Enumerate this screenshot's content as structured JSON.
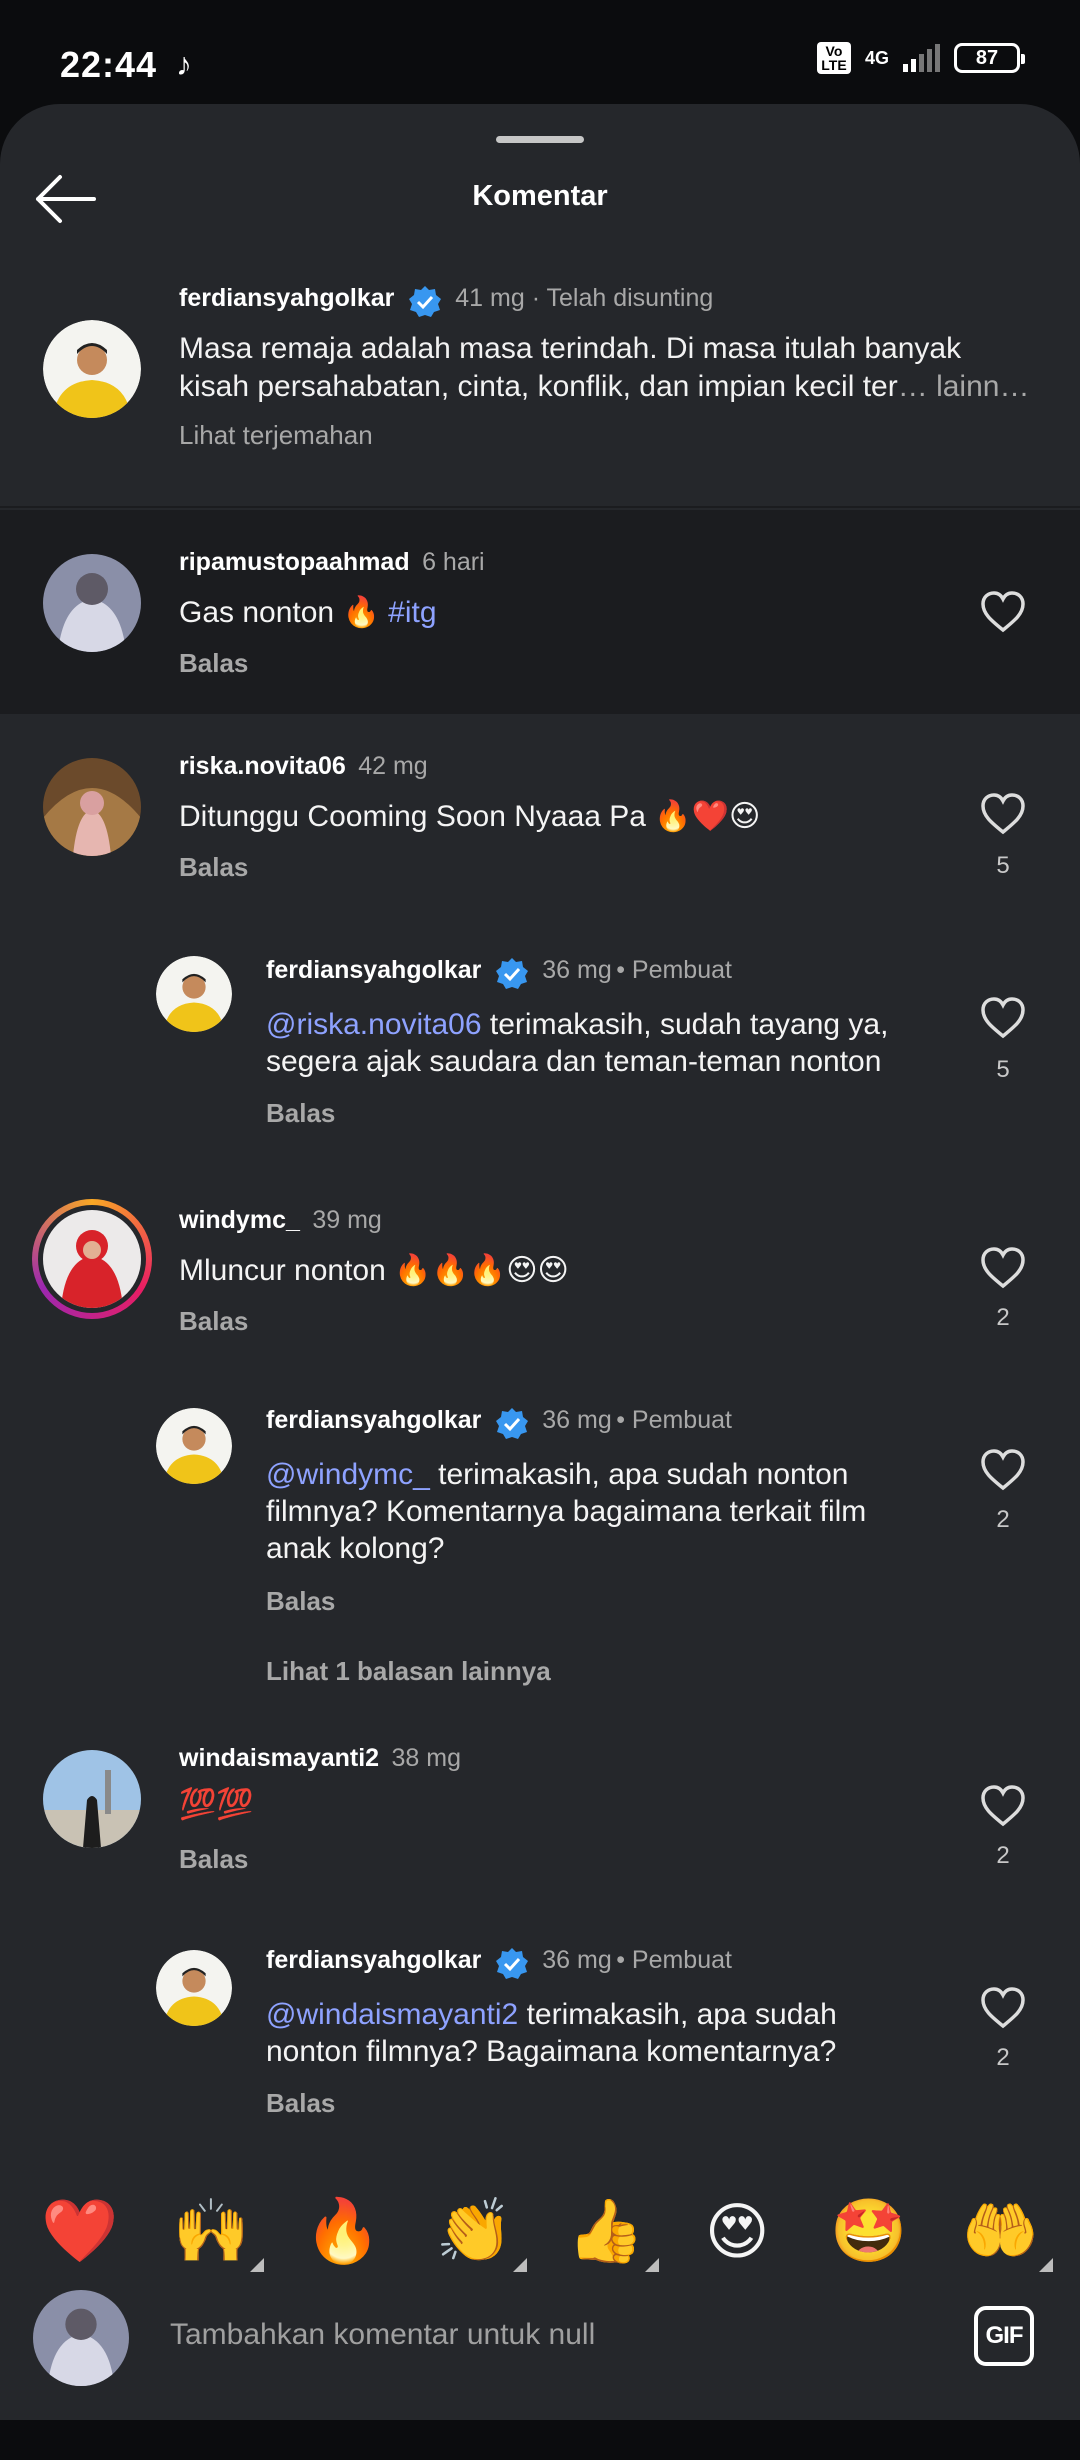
{
  "status": {
    "time": "22:44",
    "tiktok_icon": "tiktok-icon",
    "volte": "Vo LTE",
    "network": "4G",
    "battery": "87"
  },
  "header": {
    "title": "Komentar"
  },
  "caption": {
    "user": "ferdiansyahgolkar",
    "meta": "41 mg · Telah disunting",
    "line1": "Masa remaja adalah masa terindah. Di masa itulah banyak",
    "line2": "kisah persahabatan, cinta, konflik, dan impian kecil ter",
    "more": "… lainn…",
    "translate": "Lihat terjemahan"
  },
  "comments": [
    {
      "user": "ripamustopaahmad",
      "time": "6 hari",
      "text": "Gas nonton 🔥 ",
      "hashtag": "#itg",
      "reply": "Balas",
      "likes": ""
    },
    {
      "user": "riska.novita06",
      "time": "42 mg",
      "text": "Ditunggu Cooming Soon Nyaaa Pa 🔥❤️😍",
      "reply": "Balas",
      "likes": "5"
    },
    {
      "user": "ferdiansyahgolkar",
      "time": "36 mg",
      "role": "Pembuat",
      "mention": "@riska.novita06",
      "text1": " terimakasih, sudah tayang ya,",
      "text2": "segera ajak saudara dan teman-teman nonton",
      "reply": "Balas",
      "likes": "5"
    },
    {
      "user": "windymc_",
      "time": "39 mg",
      "text": "Mluncur nonton 🔥🔥🔥😍😍",
      "reply": "Balas",
      "likes": "2"
    },
    {
      "user": "ferdiansyahgolkar",
      "time": "36 mg",
      "role": "Pembuat",
      "mention": "@windymc_",
      "text1": " terimakasih, apa sudah nonton",
      "text2": "filmnya? Komentarnya bagaimana terkait film",
      "text3": "anak kolong?",
      "reply": "Balas",
      "likes": "2",
      "more_replies": "Lihat 1 balasan lainnya"
    },
    {
      "user": "windaismayanti2",
      "time": "38 mg",
      "text": "💯💯",
      "reply": "Balas",
      "likes": "2"
    },
    {
      "user": "ferdiansyahgolkar",
      "time": "36 mg",
      "role": "Pembuat",
      "mention": "@windaismayanti2",
      "text1": " terimakasih, apa sudah",
      "text2": "nonton filmnya? Bagaimana komentarnya?",
      "reply": "Balas",
      "likes": "2"
    }
  ],
  "emojis": [
    "❤️",
    "🙌",
    "🔥",
    "👏",
    "👍",
    "😍",
    "🤩",
    "🤲"
  ],
  "composer": {
    "placeholder": "Tambahkan komentar untuk null",
    "gif": "GIF"
  },
  "colors": {
    "sheet": "#25272b",
    "highlight": "#1b1c1f",
    "link": "#8ea2ff",
    "verified": "#3897f0"
  }
}
